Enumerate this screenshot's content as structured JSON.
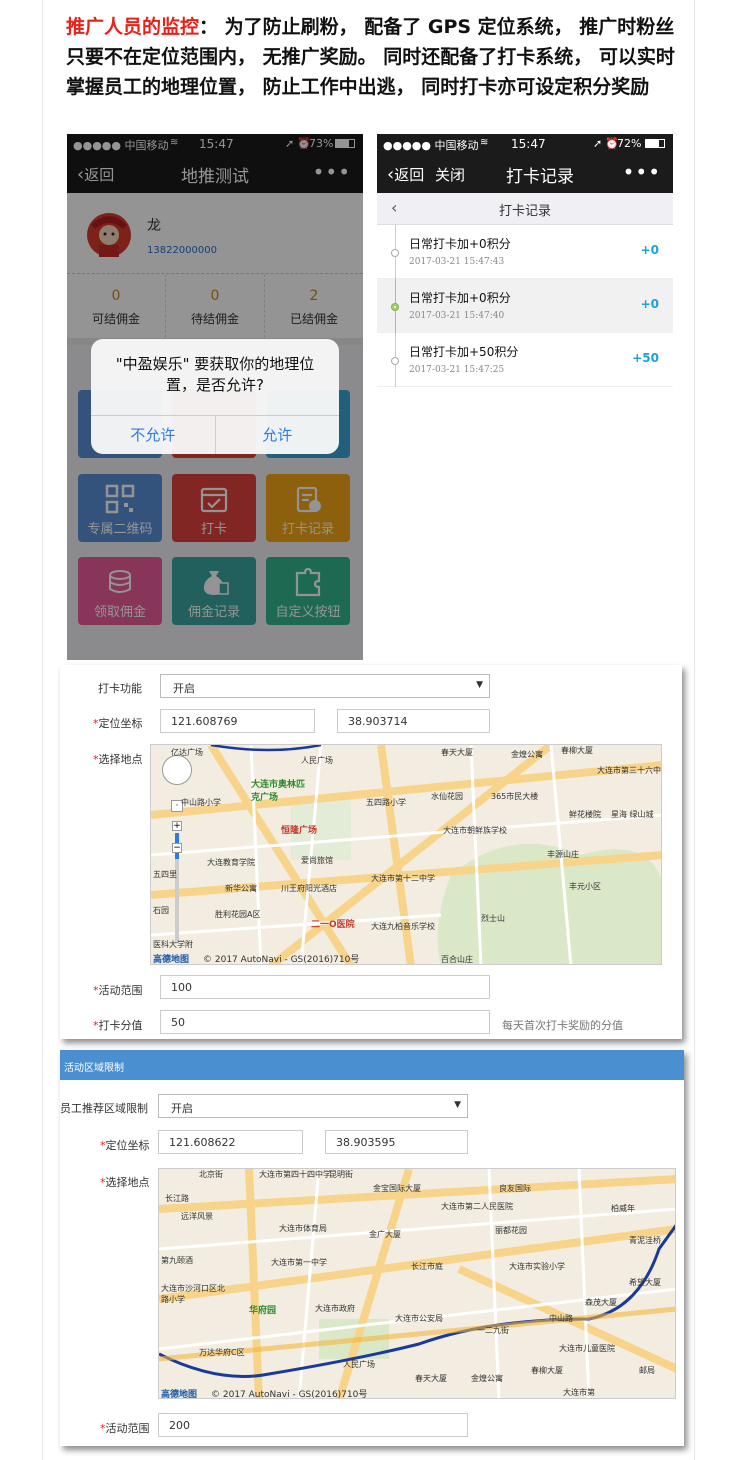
{
  "intro": {
    "highlight": "推广人员的监控",
    "text": "： 为了防止刷粉， 配备了 GPS 定位系统， 推广时粉丝只要不在定位范围内， 无推广奖励。 同时还配备了打卡系统， 可以实时掌握员工的地理位置， 防止工作中出逃， 同时打卡亦可设定积分奖励"
  },
  "phone_left": {
    "status": {
      "carrier": "●●●●● 中国移动 ",
      "wifi": "wifi-icon",
      "time": "15:47",
      "battery": "73%"
    },
    "nav": {
      "back": "返回",
      "title": "地推测试",
      "more": "•••"
    },
    "profile": {
      "name": "龙",
      "phone": "13822000000"
    },
    "stats": [
      {
        "value": "0",
        "label": "可结佣金"
      },
      {
        "value": "0",
        "label": "待结佣金"
      },
      {
        "value": "2",
        "label": "已结佣金"
      }
    ],
    "tiles": [
      {
        "label": "专属二维码",
        "icon": "qrcode-icon",
        "color": "#5b8fd6"
      },
      {
        "label": "打卡",
        "icon": "calendar-check-icon",
        "color": "#e0433f"
      },
      {
        "label": "打卡记录",
        "icon": "clipboard-check-icon",
        "color": "#f2a618"
      },
      {
        "label": "领取佣金",
        "icon": "coins-icon",
        "color": "#e85c9a"
      },
      {
        "label": "佣金记录",
        "icon": "money-bag-icon",
        "color": "#39a6a0"
      },
      {
        "label": "自定义按钮",
        "icon": "puzzle-icon",
        "color": "#34b68e"
      }
    ],
    "dialog": {
      "message": "\"中盈娱乐\" 要获取你的地理位置，是否允许?",
      "deny": "不允许",
      "allow": "允许"
    }
  },
  "phone_right": {
    "status": {
      "carrier": "●●●●● 中国移动 ",
      "time": "15:47",
      "battery": "72%"
    },
    "nav": {
      "back": "返回",
      "close": "关闭",
      "title": "打卡记录",
      "more": "•••"
    },
    "subtitle": "打卡记录",
    "records": [
      {
        "title": "日常打卡加+0积分",
        "date": "2017-03-21 15:47:43",
        "points": "+0"
      },
      {
        "title": "日常打卡加+0积分",
        "date": "2017-03-21 15:47:40",
        "points": "+0"
      },
      {
        "title": "日常打卡加+50积分",
        "date": "2017-03-21 15:47:25",
        "points": "+50"
      }
    ]
  },
  "form1": {
    "checkin_label": "打卡功能",
    "checkin_value": "开启",
    "coord_label": "定位坐标",
    "lng": "121.608769",
    "lat": "38.903714",
    "location_label": "选择地点",
    "range_label": "活动范围",
    "range_value": "100",
    "points_label": "打卡分值",
    "points_value": "50",
    "points_hint": "每天首次打卡奖励的分值",
    "map_labels": [
      "亿达广场",
      "人民广场",
      "春天大厦",
      "金煌公寓",
      "春柳大厦",
      "大连市第三十六中学",
      "大连市奥林匹克广场",
      "中山路小学",
      "五四路小学",
      "水仙花园",
      "365市民大楼",
      "鲜花楼院",
      "星海 绿山城",
      "恒隆广场",
      "大连市朝鲜族学校",
      "丰源山庄",
      "大连教育学院",
      "爱尚旅馆",
      "五四里",
      "新华公寓",
      "川王府阳光酒店",
      "大连市第十二中学",
      "丰元小区",
      "胜利花园A区",
      "二一O医院",
      "烈士山",
      "大连九柏音乐学校",
      "医科大学附",
      "石园",
      "百合山庄"
    ],
    "map_copyright": "© 2017 AutoNavi - GS(2016)710号",
    "map_logo": "高德地图"
  },
  "form2": {
    "bar_title": "活动区域限制",
    "restrict_label": "员工推荐区域限制",
    "restrict_value": "开启",
    "coord_label": "定位坐标",
    "lng": "121.608622",
    "lat": "38.903595",
    "location_label": "选择地点",
    "range_label": "活动范围",
    "range_value": "200",
    "map_labels": [
      "北京街",
      "大连市第四十四中学",
      "昆明街",
      "良友国际",
      "长江路",
      "金宝国际大厦",
      "大连市第二人民医院",
      "柏威年",
      "远洋风景",
      "大连市体育局",
      "金广大厦",
      "丽都花园",
      "青泥洼桥",
      "第九颐酒",
      "大连市第一中学",
      "长江市庭",
      "大连市实验小学",
      "希望大厦",
      "大连市沙河口区北路小学",
      "大连市政府",
      "华府园",
      "大连市公安局",
      "森茂大厦",
      "一二九街",
      "中山路",
      "万达华府C区",
      "人民广场",
      "大连市儿童医院",
      "春天大厦",
      "金煌公寓",
      "春柳大厦",
      "大连市第",
      "邮局"
    ],
    "map_copyright": "© 2017 AutoNavi - GS(2016)710号",
    "map_logo": "高德地图"
  }
}
